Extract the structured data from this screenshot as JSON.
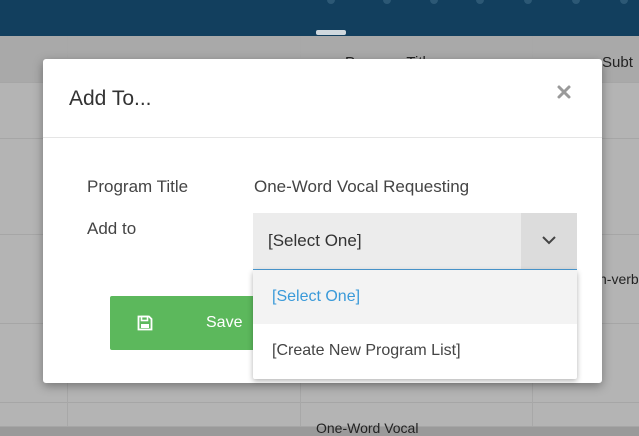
{
  "background": {
    "header_cols": [
      "Program Title",
      "Subt"
    ],
    "cell_snippet": "n-verb",
    "bottom_snippet": "One-Word Vocal"
  },
  "modal": {
    "title": "Add To...",
    "program_title_label": "Program Title",
    "program_title_value": "One-Word Vocal Requesting",
    "add_to_label": "Add to",
    "select": {
      "selected": "[Select One]",
      "options": [
        "[Select One]",
        "[Create New Program List]"
      ]
    },
    "save_label": "Save"
  },
  "colors": {
    "primary_bar": "#123f5e",
    "save_green": "#5cb85c",
    "select_accent": "#4a9bd4",
    "active_option": "#3a9ad9"
  },
  "icons": [
    "close-icon",
    "chevron-down-icon",
    "floppy-disk-icon"
  ]
}
